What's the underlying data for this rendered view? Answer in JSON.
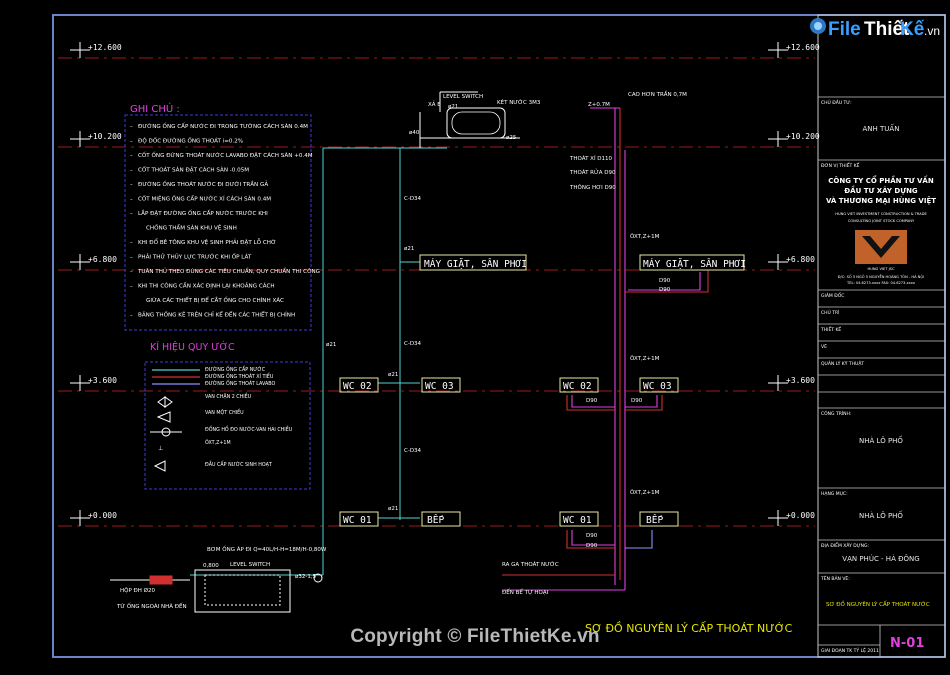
{
  "watermark": {
    "logo_file": "File",
    "logo_thiet": "Thiết",
    "logo_ke": "Kế",
    "logo_vn": ".vn",
    "copyright": "Copyright © FileThietKe.vn"
  },
  "levels": {
    "l1": "+12.600",
    "l2": "+10.200",
    "l3": "+6.800",
    "l4": "+3.600",
    "l5": "+0.000"
  },
  "notes": {
    "title": "GHI CHÚ :",
    "items": [
      "ĐƯỜNG ỐNG CẤP NƯỚC ĐI TRONG TƯỜNG CÁCH SÀN 0.4M",
      "ĐỘ DỐC ĐƯỜNG ỐNG THOÁT i=0.2%",
      "CỐT ỐNG ĐỨNG THOÁT NƯỚC LAVABO ĐẶT CÁCH SÀN +0.4M",
      "CỐT THOÁT SÀN ĐẶT CÁCH SÀN -0.05M",
      "ĐƯỜNG ỐNG THOÁT NƯỚC ĐI DƯỚI TRẦN GẢ",
      "CỐT MIỆNG ỐNG CẤP NƯỚC XÍ CÁCH SÀN 0.4M",
      "LẮP ĐẶT ĐƯỜNG ỐNG CẤP NƯỚC TRƯỚC KHI",
      "CHỐNG THẤM SÀN KHU VỆ SINH",
      "KHI ĐỔ BÊ TÔNG KHU VỆ SINH PHẢI ĐẶT LỖ CHỜ",
      "PHẢI THỬ THỦY LỰC TRƯỚC KHI ỐP LÁT",
      "TUÂN THỦ THEO ĐÚNG CÁC TIÊU CHUẨN, QUY  CHUẨN THI CÔNG",
      "KHI THI CÔNG CẦN XÁC ĐỊNH LẠI KHOẢNG CÁCH",
      "GIỮA CÁC THIẾT BỊ ĐỂ CẮT ỐNG CHO CHÍNH XÁC",
      "BẢNG THỐNG KÊ TRÊN CHỈ KỂ ĐẾN CÁC THIẾT BỊ CHÍNH"
    ]
  },
  "legend": {
    "title": "KÍ HIỆU QUY ƯỚC",
    "rows": [
      "ĐƯỜNG ỐNG CẤP NƯỚC",
      "ĐƯỜNG ỐNG THOÁT XÍ TIỂU",
      "ĐƯỜNG ỐNG THOÁT LAVABO",
      "VAN CHẶN 2 CHIỀU",
      "VAN MỘT CHIỀU",
      "ĐỒNG HỒ ĐO NƯỚC-VAN HAI CHIỀU",
      "ÔXT,Z+1M",
      "ĐẦU CẤP NƯỚC SINH HOẠT"
    ]
  },
  "rooms": {
    "may_giat_left": "MÁY GIẶT, SÂN PHƠI",
    "may_giat_right": "MÁY GIẶT, SÂN PHƠI",
    "wc02_left": "WC 02",
    "wc03_left": "WC 03",
    "wc01_left": "WC 01",
    "bep_left": "BẾP",
    "wc02_right": "WC 02",
    "wc03_right": "WC 03",
    "wc01_right": "WC 01",
    "bep_right": "BẾP"
  },
  "labels": {
    "level_switch_top": "LEVEL SWITCH",
    "ket_nuoc": "KÉT NƯỚC 3M3",
    "xa_e": "XẢ E",
    "cao_hon_tran": "CAO HƠN TRẦN 0,7M",
    "z_plus": "Z+0.7M",
    "thoat_xi": "THOÁT XÍ D110",
    "thoat_rua": "THOÁT RỬA D90",
    "thong_hoi": "THÔNG HƠI D90",
    "c_d34_a": "C-D34",
    "c_d34_b": "C-D34",
    "c_d34_c": "C-D34",
    "phi21_a": "ø21",
    "phi21_b": "ø21",
    "phi21_c": "ø21",
    "phi21_d": "ø21",
    "phi21_e": "ø21",
    "phi25": "ø25",
    "phi40": "ø40",
    "oxt_a": "ÔXT,Z+1M",
    "oxt_b": "ÔXT,Z+1M",
    "oxt_c": "ÔXT,Z+1M",
    "d90_a": "D90",
    "d90_b": "D90",
    "d90_c": "D90",
    "d90_d": "D90",
    "d90_e": "D90",
    "d90_f": "D90",
    "bon_ngam": "BƠM ỐNG ÁP ĐI Q=40L/H-H=18M/H-0,80W",
    "level_switch_bottom": "LEVEL SWITCH",
    "hop_dh": "HỘP ĐH Ø20",
    "tu_ong": "TỪ ỐNG NGOÀI NHÀ ĐẾN",
    "ra_ga": "RA GA THOÁT NƯỚC",
    "den_be": "ĐẾN BỂ TỰ HOẠI",
    "pump_size": "ø32-1,5",
    "pipe_0800": "0,800",
    "diagram_title": "SƠ ĐỒ NGUYÊN LÝ CẤP THOÁT NƯỚC"
  },
  "title_block": {
    "chu_dau_tu_label": "CHỦ ĐẦU TƯ:",
    "chu_dau_tu": "ANH TUẤN",
    "don_vi_label": "ĐƠN VỊ THIẾT KẾ",
    "company_1": "CÔNG TY CỔ PHẦN TƯ VẤN",
    "company_2": "ĐẦU TƯ XÂY DỰNG",
    "company_3": "VÀ THƯƠNG MẠI HÙNG VIỆT",
    "company_en_1": "HUNG VIET INVESTMENT CONSTRUCTION & TRADE",
    "company_en_2": "CONSULTING JOINT STOCK COMPANY",
    "logo_caption": "HUNG VIET JSC",
    "address_1": "Đ/C: SỐ 5 NGÕ 5 NGUYỄN HOÀNG TÔN - HÀ NỘI",
    "address_2": "TEL: 04.6273.xxxx  FAX: 04.6273.xxxx",
    "giam_doc": "GIÁM ĐỐC",
    "chu_tri": "CHỦ TRÌ",
    "thiet_ke": "THIẾT KẾ",
    "ve": "VẼ",
    "quan_ly": "QUẢN LÝ KỸ THUẬT",
    "cong_trinh_label": "CÔNG TRÌNH:",
    "cong_trinh": "NHÀ LÔ PHỐ",
    "hang_muc_label": "HẠNG MỤC:",
    "hang_muc": "NHÀ LÔ PHỐ",
    "dia_diem_label": "ĐỊA ĐIỂM XÂY DỰNG:",
    "dia_diem": "VẠN PHÚC - HÀ ĐÔNG",
    "ten_ban_ve_label": "TÊN BẢN VẼ:",
    "ten_ban_ve": "SƠ ĐỒ NGUYÊN LÝ CẤP THOÁT NƯỚC",
    "ty_le": "GIAI ĐOẠN TK   TỶ LỆ   2011",
    "sheet": "N-01"
  }
}
